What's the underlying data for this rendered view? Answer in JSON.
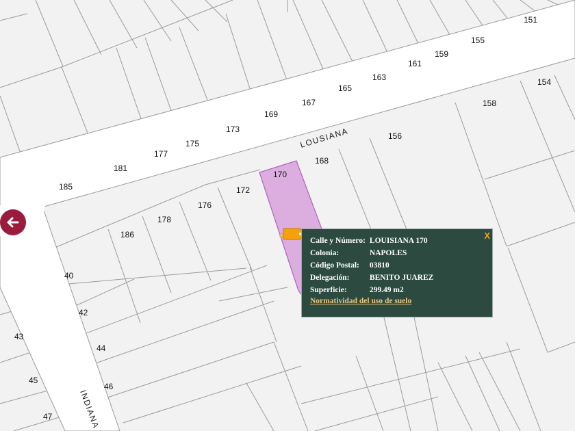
{
  "map": {
    "streets": [
      {
        "id": "louisiana",
        "name": "LOUSIANA"
      },
      {
        "id": "indiana",
        "name": "INDIANA"
      }
    ],
    "lot_numbers": [
      "151",
      "155",
      "159",
      "161",
      "163",
      "165",
      "167",
      "169",
      "173",
      "175",
      "177",
      "181",
      "185",
      "154",
      "158",
      "156",
      "168",
      "170",
      "172",
      "176",
      "178",
      "186",
      "40",
      "42",
      "43",
      "44",
      "45",
      "46",
      "47"
    ],
    "selected_lot": "170",
    "colors": {
      "background": "#f2f2f2",
      "street": "#ffffff",
      "lot_line": "#9a9a9a",
      "selection_fill": "#dcaee0",
      "selection_stroke": "#b05fb8",
      "pin": "#f5a10b",
      "back_button": "#9b1b3c",
      "popup_bg": "#2c4a40",
      "popup_link": "#e7c680"
    }
  },
  "controls": {
    "back_icon": "arrow-left-icon"
  },
  "popup": {
    "close_label": "X",
    "rows": [
      {
        "label": "Calle y Número:",
        "value": "LOUISIANA 170"
      },
      {
        "label": "Colonia:",
        "value": "NAPOLES"
      },
      {
        "label": "Código Postal:",
        "value": "03810"
      },
      {
        "label": "Delegación:",
        "value": "BENITO JUAREZ"
      },
      {
        "label": "Superficie:",
        "value": "299.49 m2"
      }
    ],
    "link_text": "Normatividad del uso de suelo"
  }
}
